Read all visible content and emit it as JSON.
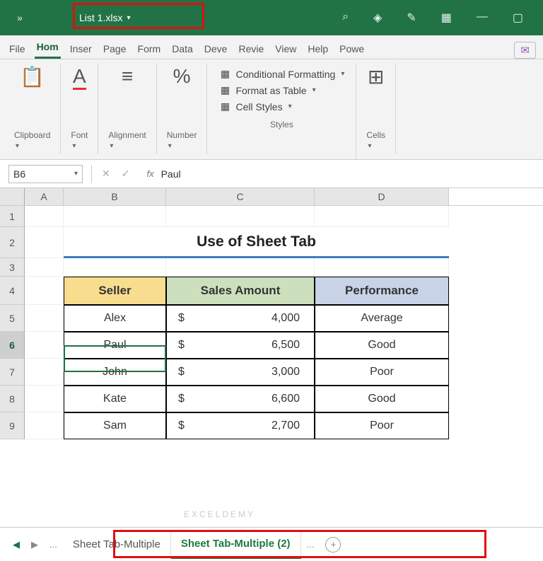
{
  "titlebar": {
    "overflow": "»",
    "filename": "List 1.xlsx",
    "icons": [
      "search-icon",
      "diamond-icon",
      "pen-icon",
      "layout-icon",
      "minimize-icon",
      "maximize-icon"
    ]
  },
  "tabs": {
    "items": [
      "File",
      "Hom",
      "Inser",
      "Page",
      "Form",
      "Data",
      "Deve",
      "Revie",
      "View",
      "Help",
      "Powe"
    ],
    "active_index": 1
  },
  "ribbon": {
    "clipboard": {
      "label": "Clipboard"
    },
    "font": {
      "label": "Font"
    },
    "alignment": {
      "label": "Alignment"
    },
    "number": {
      "label": "Number"
    },
    "styles": {
      "cond": "Conditional Formatting",
      "table": "Format as Table",
      "cell": "Cell Styles",
      "label": "Styles"
    },
    "cells": {
      "label": "Cells"
    }
  },
  "namebox": {
    "ref": "B6"
  },
  "formula": {
    "value": "Paul",
    "fx": "fx"
  },
  "columns": [
    "",
    "A",
    "B",
    "C",
    "D"
  ],
  "row_numbers": [
    "1",
    "2",
    "3",
    "4",
    "5",
    "6",
    "7",
    "8",
    "9"
  ],
  "selected_row_index": 5,
  "chart_data": {
    "type": "table",
    "title": "Use of Sheet Tab",
    "headers": [
      "Seller",
      "Sales Amount",
      "Performance"
    ],
    "rows": [
      {
        "seller": "Alex",
        "currency": "$",
        "amount": "4,000",
        "perf": "Average"
      },
      {
        "seller": "Paul",
        "currency": "$",
        "amount": "6,500",
        "perf": "Good"
      },
      {
        "seller": "John",
        "currency": "$",
        "amount": "3,000",
        "perf": "Poor"
      },
      {
        "seller": "Kate",
        "currency": "$",
        "amount": "6,600",
        "perf": "Good"
      },
      {
        "seller": "Sam",
        "currency": "$",
        "amount": "2,700",
        "perf": "Poor"
      }
    ]
  },
  "sheet_tabs": {
    "items": [
      "Sheet Tab-Multiple",
      "Sheet Tab-Multiple (2)"
    ],
    "active_index": 1,
    "ellipsis": "..."
  },
  "watermark": "EXCELDEMY"
}
